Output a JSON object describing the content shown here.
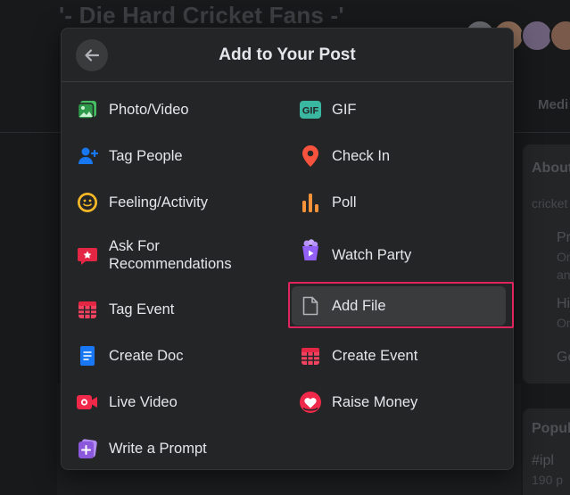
{
  "background": {
    "group_title": "'- Die Hard Cricket Fans -'",
    "tab_partial": "Medi",
    "sidebar": {
      "about": "About",
      "line1": "cricket",
      "private": "Pr",
      "private_sub1": "On",
      "private_sub2": "an",
      "visible": "Hi",
      "visible_sub": "On",
      "general": "Ge",
      "popular": "Popul",
      "hashtag": "#ipl",
      "posts": "190 p"
    }
  },
  "modal": {
    "title": "Add to Your Post",
    "back_icon": "arrow-left-icon",
    "options_left": [
      {
        "label": "Photo/Video",
        "icon": "photo-video-icon",
        "color": "#45bd62"
      },
      {
        "label": "Tag People",
        "icon": "tag-people-icon",
        "color": "#1877f2"
      },
      {
        "label": "Feeling/Activity",
        "icon": "feeling-icon",
        "color": "#f7b928"
      },
      {
        "label": "Ask For\nRecommendations",
        "icon": "recommendations-icon",
        "color": "#e42645"
      },
      {
        "label": "Tag Event",
        "icon": "calendar-icon",
        "color": "#f3425f"
      },
      {
        "label": "Create Doc",
        "icon": "document-icon",
        "color": "#1877f2"
      },
      {
        "label": "Live Video",
        "icon": "live-video-icon",
        "color": "#f02849"
      },
      {
        "label": "Write a Prompt",
        "icon": "prompt-icon",
        "color": "#8c58db"
      }
    ],
    "options_right": [
      {
        "label": "GIF",
        "icon": "gif-icon",
        "color": "#3ab7a0"
      },
      {
        "label": "Check In",
        "icon": "location-pin-icon",
        "color": "#f5533d"
      },
      {
        "label": "Poll",
        "icon": "poll-icon",
        "color": "#f7923b"
      },
      {
        "label": "Watch Party",
        "icon": "watch-party-icon",
        "color": "#9360f7"
      },
      {
        "label": "Add File",
        "icon": "file-icon",
        "color": "#b0b3b8"
      },
      {
        "label": "Create Event",
        "icon": "calendar-icon",
        "color": "#f3425f"
      },
      {
        "label": "Raise Money",
        "icon": "heart-donation-icon",
        "color": "#f02849"
      }
    ],
    "highlighted_option": "Add File"
  }
}
